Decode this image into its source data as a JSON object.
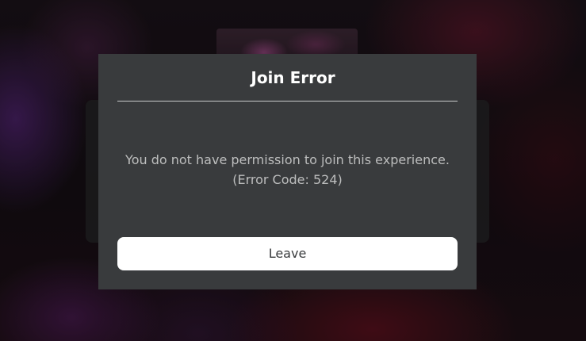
{
  "dialog": {
    "title": "Join Error",
    "message_line1": "You do not have permission to join this experience.",
    "message_line2": "(Error Code: 524)",
    "leave_label": "Leave"
  },
  "colors": {
    "dialog_background": "#393b3d",
    "title_text": "#ffffff",
    "message_text": "#bdbebe",
    "divider": "#c9cacb",
    "button_background": "#ffffff",
    "button_text": "#393b3d"
  }
}
